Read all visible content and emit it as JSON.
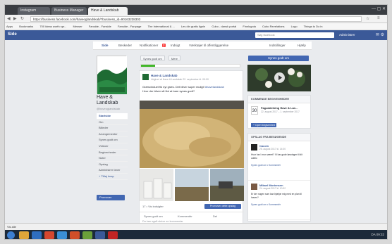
{
  "browser": {
    "tabs": [
      "Instagram",
      "Business Manager",
      "Have & Landskab"
    ],
    "url": "https://business.facebook.com/haveoglandskab/?business_id=90163238303",
    "bookmarks": [
      "Apps",
      "Bookmarks",
      "700 ideas worth spr...",
      "Messer",
      "Fanside - Fanside",
      "Fanside - Fanpage",
      "The International & ...",
      "Les din gratis lignin",
      "Cubo - dansk portal",
      "Finnlognia",
      "Cubo Revelations",
      "Logo",
      "Things to Do in"
    ]
  },
  "fb": {
    "logo": "Side",
    "search_placeholder": "Søg facebook",
    "user": "Administrer"
  },
  "page_nav": {
    "items": [
      "Side",
      "Beskeder",
      "Notifikationer",
      "Indsigt",
      "Værktøjer til offentliggørelse",
      "Indstillinger",
      "Hjælp"
    ],
    "notif_badge": "2"
  },
  "page": {
    "name": "Have & Landskab",
    "handle": "@haveoglandskab",
    "menu": [
      "Startside",
      "Om",
      "Billeder",
      "Arrangementer",
      "Synes godt om",
      "Videoer",
      "Begivenheder",
      "Noter",
      "Opslag",
      "Administrer faner"
    ],
    "add_button": "+ Tilføj knap",
    "promote": "Promover"
  },
  "post": {
    "top_buttons": [
      "Synes godt om",
      "Mere"
    ],
    "progress": 0.14,
    "author": "Have & Landskab",
    "meta": "Udgivet af Have & Landskab 22. september kl. 09:00",
    "text1": "Græsvinduet fik nyt græs. Det bliver super muligt!",
    "text2": "Hvor der bliver så flot at bare synes godt?",
    "link": "#havelandskab",
    "likes": "17 • Vis indsigter",
    "boost": "Promover dette opslag",
    "actions": [
      "Synes godt om",
      "Kommentér",
      "Del"
    ],
    "comment_hint": "Du kan også skrive en kommentar"
  },
  "right": {
    "like_button": "Synes godt om",
    "events_title": "KOMMENDE BEGIVENHEDER",
    "event": {
      "day": "30",
      "title": "Faguddelning Have & Lan...",
      "meta": "22. august 2017 – 1. september 2017"
    },
    "add_event": "+ Opret begivenhed",
    "posts_title": "OPSLAG FRA BESØGENDE",
    "posts": [
      {
        "name": "Caccin",
        "meta": "25. august 2017 kl. 14:00",
        "text": "Hvor har I mon været? Vi har gode løsninger til dit udeliv.",
        "link": "Synes godt om • Kommentér"
      },
      {
        "name": "Mikael Mortensen",
        "meta": "24. august 2017 kl. 10:32",
        "text": "Er der nogen som kan hjælpe mig med en plan til haven?",
        "link": "Synes godt om • Kommentér"
      }
    ]
  },
  "statusbar": "Vis alle",
  "taskbar": {
    "tray": "DA 09:32"
  }
}
